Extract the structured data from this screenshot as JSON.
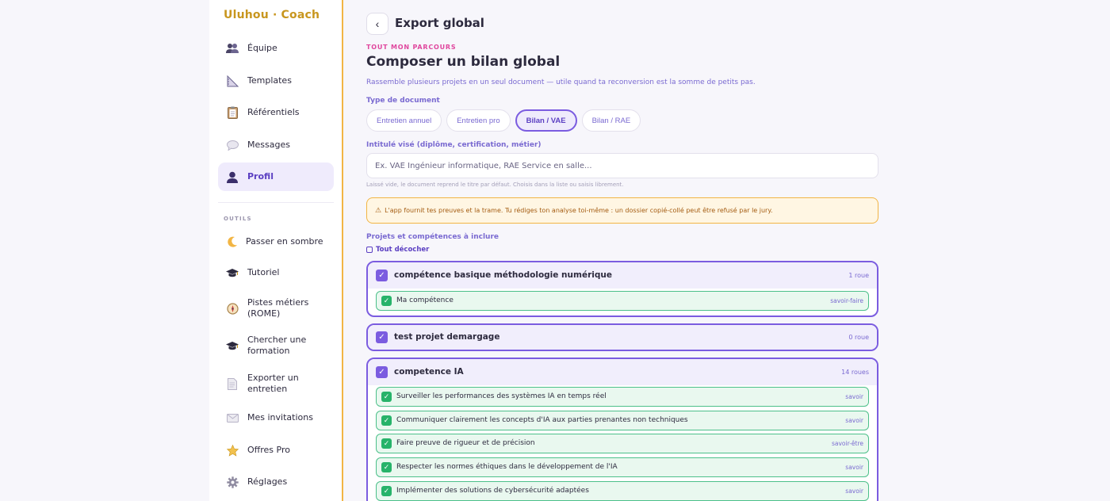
{
  "app": {
    "brand": "Uluhou · Coach"
  },
  "sidebar": {
    "items": [
      {
        "label": "Équipe",
        "icon": "team-icon"
      },
      {
        "label": "Templates",
        "icon": "ruler-icon"
      },
      {
        "label": "Référentiels",
        "icon": "clipboard-icon"
      },
      {
        "label": "Messages",
        "icon": "speech-bubble-icon"
      },
      {
        "label": "Profil",
        "icon": "user-icon",
        "active": true
      }
    ],
    "tools_title": "OUTILS",
    "tools": [
      {
        "label": "Passer en sombre",
        "icon": "moon-icon"
      },
      {
        "label": "Tutoriel",
        "icon": "graduation-cap-icon"
      },
      {
        "label": "Pistes métiers (ROME)",
        "icon": "compass-icon"
      },
      {
        "label": "Chercher une formation",
        "icon": "graduation-cap-icon"
      },
      {
        "label": "Exporter un entretien",
        "icon": "document-icon"
      },
      {
        "label": "Mes invitations",
        "icon": "envelope-icon"
      },
      {
        "label": "Offres Pro",
        "icon": "star-icon"
      },
      {
        "label": "Réglages",
        "icon": "gear-icon"
      }
    ]
  },
  "header": {
    "back": "‹",
    "title": "Export global"
  },
  "main": {
    "eyebrow": "TOUT MON PARCOURS",
    "title": "Composer un bilan global",
    "subtitle": "Rassemble plusieurs projets en un seul document — utile quand ta reconversion est la somme de petits pas.",
    "doc_type_label": "Type de document",
    "doc_types": [
      {
        "label": "Entretien annuel",
        "active": false
      },
      {
        "label": "Entretien pro",
        "active": false
      },
      {
        "label": "Bilan / VAE",
        "active": true
      },
      {
        "label": "Bilan / RAE",
        "active": false
      }
    ],
    "title_label": "Intitulé visé (diplôme, certification, métier)",
    "title_placeholder": "Ex. VAE Ingénieur informatique, RAE Service en salle...",
    "title_hint": "Laissé vide, le document reprend le titre par défaut. Choisis dans la liste ou saisis librement.",
    "warning_icon": "⚠",
    "warning": "L'app fournit tes preuves et la trame. Tu rédiges ton analyse toi-même : un dossier copié-collé peut être refusé par le jury.",
    "include_label": "Projets et compétences à inclure",
    "toggle_all": "Tout décocher",
    "groups": [
      {
        "title": "compétence basique méthodologie numérique",
        "count": "1 roue",
        "competences": [
          {
            "label": "Ma compétence",
            "type": "savoir-faire"
          }
        ]
      },
      {
        "title": "test projet demargage",
        "count": "0 roue",
        "competences": []
      },
      {
        "title": "competence IA",
        "count": "14 roues",
        "competences": [
          {
            "label": "Surveiller les performances des systèmes IA en temps réel",
            "type": "savoir"
          },
          {
            "label": "Communiquer clairement les concepts d'IA aux parties prenantes non techniques",
            "type": "savoir"
          },
          {
            "label": "Faire preuve de rigueur et de précision",
            "type": "savoir-être"
          },
          {
            "label": "Respecter les normes éthiques dans le développement de l'IA",
            "type": "savoir"
          },
          {
            "label": "Implémenter des solutions de cybersécurité adaptées",
            "type": "savoir"
          }
        ]
      }
    ]
  },
  "colors": {
    "accent": "#7b5ce0",
    "brand": "#c8961e",
    "eyebrow": "#e0479e",
    "success": "#27b36a",
    "warning": "#f2b544"
  }
}
